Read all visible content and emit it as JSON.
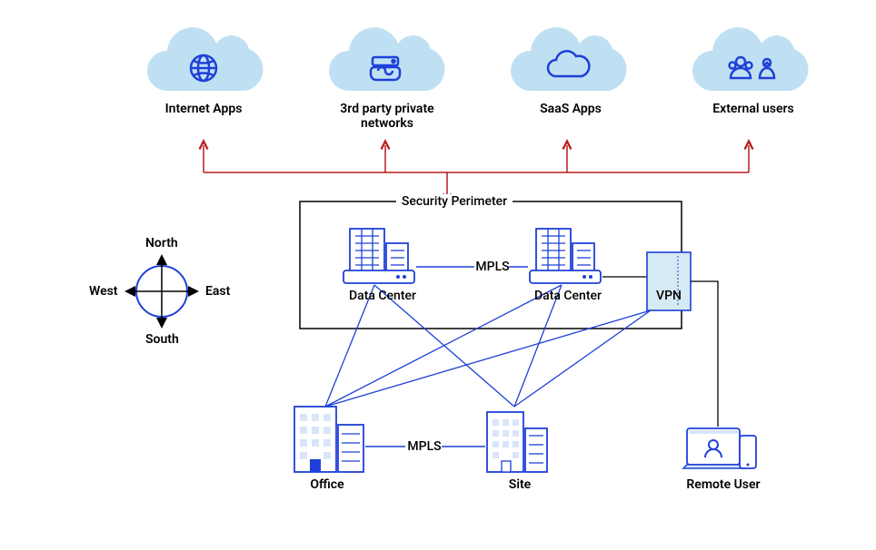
{
  "clouds": {
    "internet_apps": "Internet Apps",
    "third_party": "3rd party private networks",
    "saas": "SaaS Apps",
    "external_users": "External users"
  },
  "perimeter": {
    "title": "Security Perimeter",
    "dc1": "Data Center",
    "dc2": "Data Center",
    "mpls1": "MPLS",
    "vpn": "VPN"
  },
  "bottom": {
    "office": "Office",
    "site": "Site",
    "remote_user": "Remote User",
    "mpls2": "MPLS"
  },
  "compass": {
    "north": "North",
    "south": "South",
    "east": "East",
    "west": "West"
  }
}
